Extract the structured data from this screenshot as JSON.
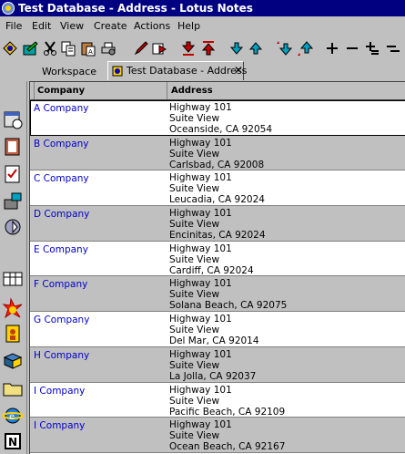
{
  "window": {
    "title": "Test Database - Address - Lotus Notes"
  },
  "menu": [
    "File",
    "Edit",
    "View",
    "Create",
    "Actions",
    "Help"
  ],
  "tabs": {
    "workspace": "Workspace",
    "active": "Test Database - Address",
    "close": "✕"
  },
  "columns": {
    "company": "Company",
    "address": "Address"
  },
  "rows": [
    {
      "company": "A Company",
      "street": "Highway 101",
      "suite": "Suite View",
      "city": "Oceanside, CA  92054"
    },
    {
      "company": "B Company",
      "street": "Highway 101",
      "suite": "Suite View",
      "city": "Carlsbad, CA  92008"
    },
    {
      "company": "C Company",
      "street": "Highway 101",
      "suite": "Suite View",
      "city": "Leucadia, CA  92024"
    },
    {
      "company": "D Company",
      "street": "Highway 101",
      "suite": "Suite View",
      "city": "Encinitas, CA  92024"
    },
    {
      "company": "E Company",
      "street": "Highway 101",
      "suite": "Suite View",
      "city": "Cardiff, CA  92024"
    },
    {
      "company": "F Company",
      "street": "Highway 101",
      "suite": "Suite View",
      "city": "Solana Beach, CA  92075"
    },
    {
      "company": "G Company",
      "street": "Highway 101",
      "suite": "Suite View",
      "city": "Del Mar, CA  92014"
    },
    {
      "company": "H Company",
      "street": "Highway 101",
      "suite": "Suite View",
      "city": "La Jolla, CA  92037"
    },
    {
      "company": "I Company",
      "street": "Highway 101",
      "suite": "Suite View",
      "city": "Pacific Beach, CA  92109"
    },
    {
      "company": "I Company",
      "street": "Highway 101",
      "suite": "Suite View",
      "city": "Ocean Beach, CA  92167"
    }
  ],
  "toolbar_icons": [
    "bookmark-icon",
    "edit-document-icon",
    "cut-icon",
    "copy-icon",
    "paste-icon",
    "print-icon",
    "pen-icon",
    "forward-icon",
    "previous-unread-icon",
    "next-unread-icon",
    "previous-icon",
    "next-icon",
    "previous-marked-icon",
    "next-marked-icon",
    "expand-icon",
    "collapse-icon",
    "expand-all-icon",
    "collapse-all-icon"
  ],
  "sidebar_icons": [
    "calendar-icon",
    "address-book-icon",
    "todo-icon",
    "phone-icon",
    "replicator-icon",
    "workspace-icon",
    "alarm-icon",
    "agent-icon",
    "database-icon",
    "folder-icon",
    "internet-icon",
    "notes-icon"
  ],
  "colors": {
    "title_bar": "#000080",
    "link_blue": "#0000cc",
    "row_alt": "#c0c0c0"
  }
}
